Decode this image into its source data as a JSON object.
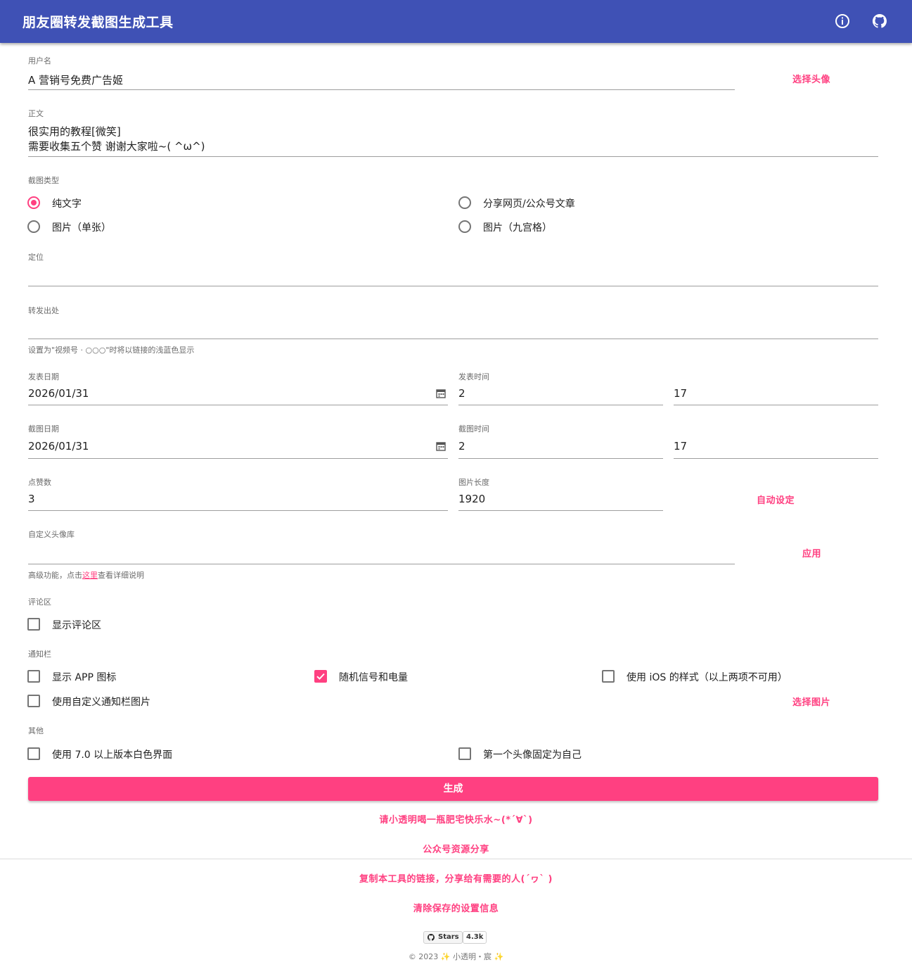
{
  "header": {
    "title": "朋友圈转发截图生成工具",
    "info_icon": "info-icon",
    "github_icon": "github-icon"
  },
  "colors": {
    "primary": "#3f51b5",
    "accent": "#ff4081"
  },
  "username": {
    "label": "用户名",
    "value": "A 营销号免费广告姬",
    "avatar_button": "选择头像"
  },
  "body_text": {
    "label": "正文",
    "line1": "很实用的教程[微笑]",
    "line2": "需要收集五个赞 谢谢大家啦~(  ^ω^)"
  },
  "screenshot_type": {
    "label": "截图类型",
    "options": [
      {
        "label": "纯文字",
        "checked": true
      },
      {
        "label": "分享网页/公众号文章",
        "checked": false
      },
      {
        "label": "图片（单张）",
        "checked": false
      },
      {
        "label": "图片（九宫格）",
        "checked": false
      }
    ]
  },
  "location": {
    "label": "定位",
    "value": ""
  },
  "forward_source": {
    "label": "转发出处",
    "value": "",
    "help": "设置为\"视频号 · ○○○\"时将以链接的浅蓝色显示"
  },
  "publish": {
    "date_label": "发表日期",
    "date": "2026/01/31",
    "time_label": "发表时间",
    "hour": "2",
    "minute": "17"
  },
  "capture": {
    "date_label": "截图日期",
    "date": "2026/01/31",
    "time_label": "截图时间",
    "hour": "2",
    "minute": "17"
  },
  "likes": {
    "label": "点赞数",
    "value": "3"
  },
  "image_length": {
    "label": "图片长度",
    "value": "1920",
    "auto_button": "自动设定"
  },
  "avatar_library": {
    "label": "自定义头像库",
    "value": "",
    "apply_button": "应用",
    "help_prefix": "高级功能，点击",
    "help_link": "这里",
    "help_suffix": "查看详细说明"
  },
  "comments": {
    "section": "评论区",
    "show_label": "显示评论区",
    "show_checked": false
  },
  "notification": {
    "section": "通知栏",
    "app_icon": {
      "label": "显示 APP 图标",
      "checked": false
    },
    "random_signal": {
      "label": "随机信号和电量",
      "checked": true
    },
    "ios_style": {
      "label": "使用 iOS 的样式（以上两项不可用）",
      "checked": false
    },
    "custom_image": {
      "label": "使用自定义通知栏图片",
      "checked": false
    },
    "select_image_button": "选择图片"
  },
  "other": {
    "section": "其他",
    "white_ui": {
      "label": "使用 7.0 以上版本白色界面",
      "checked": false
    },
    "fix_avatar": {
      "label": "第一个头像固定为自己",
      "checked": false
    }
  },
  "actions": {
    "generate": "生成",
    "donate": "请小透明喝一瓶肥宅快乐水~(*´∀`)",
    "wechat_share": "公众号资源分享",
    "copy_link": "复制本工具的链接，分享给有需要的人(´ヮ` )",
    "clear_settings": "清除保存的设置信息"
  },
  "footer": {
    "stars_label": "Stars",
    "stars_count": "4.3k",
    "copyright": "© 2023 ✨ 小透明・宸 ✨"
  }
}
